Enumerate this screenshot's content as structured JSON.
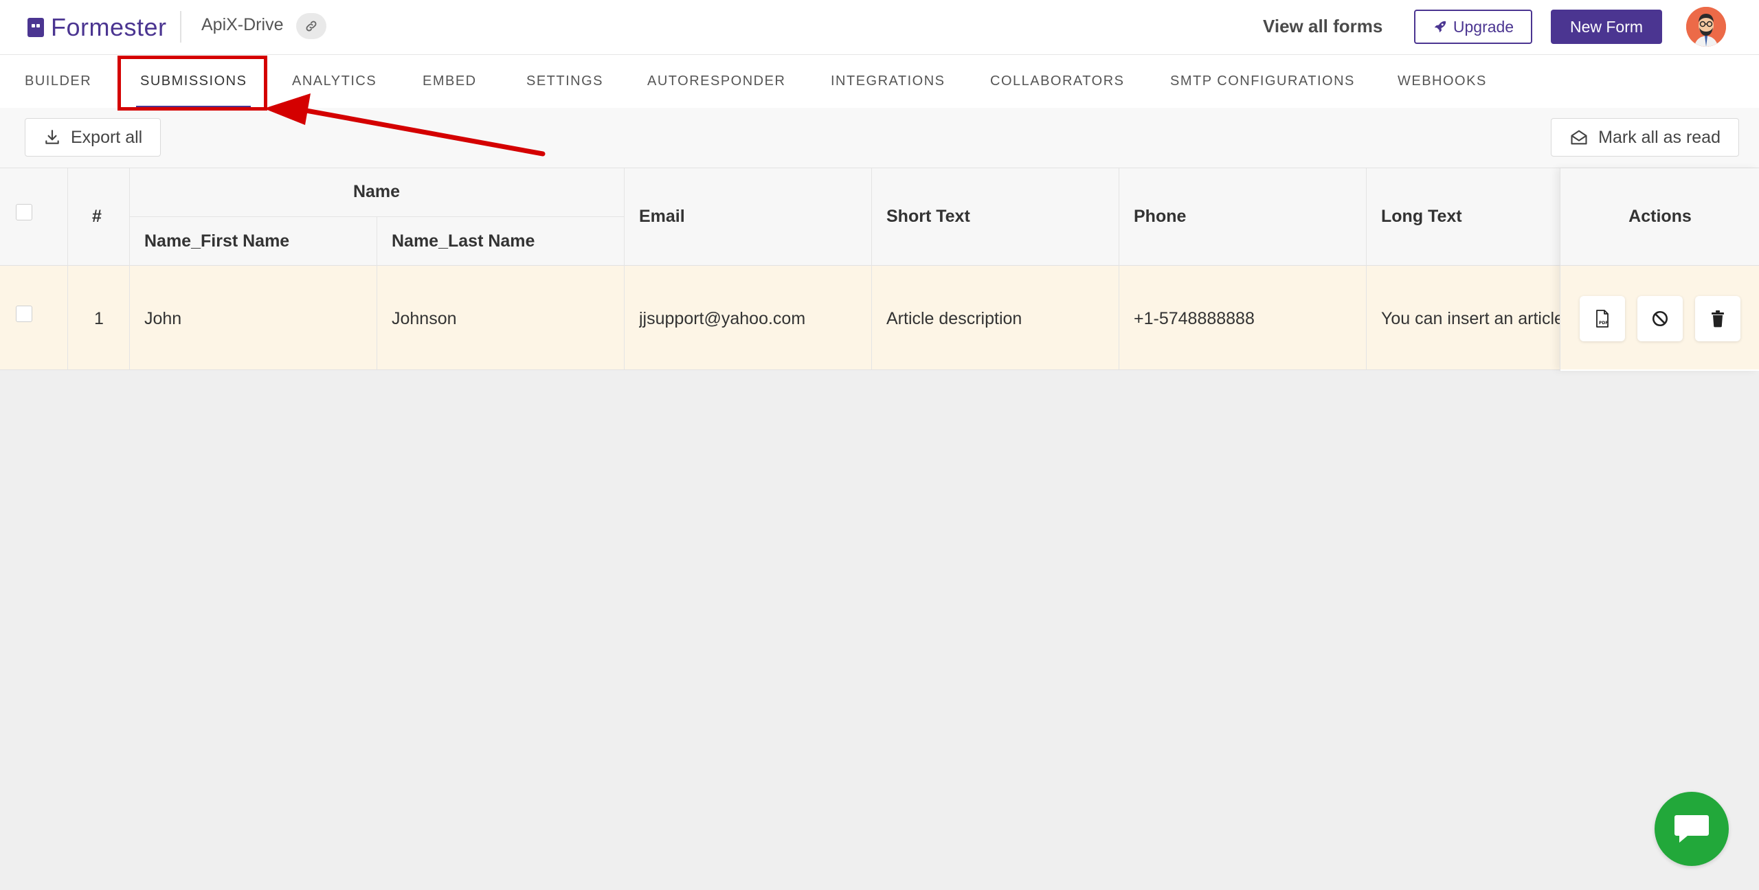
{
  "header": {
    "logo_text": "Formester",
    "form_name": "ApiX-Drive",
    "view_all_forms": "View all forms",
    "upgrade_label": "Upgrade",
    "new_form_label": "New Form"
  },
  "tabs": [
    {
      "label": "BUILDER",
      "active": false
    },
    {
      "label": "SUBMISSIONS",
      "active": true
    },
    {
      "label": "ANALYTICS",
      "active": false
    },
    {
      "label": "EMBED",
      "active": false
    },
    {
      "label": "SETTINGS",
      "active": false
    },
    {
      "label": "AUTORESPONDER",
      "active": false
    },
    {
      "label": "INTEGRATIONS",
      "active": false
    },
    {
      "label": "COLLABORATORS",
      "active": false
    },
    {
      "label": "SMTP CONFIGURATIONS",
      "active": false
    },
    {
      "label": "WEBHOOKS",
      "active": false
    }
  ],
  "toolbar": {
    "export_label": "Export all",
    "mark_read_label": "Mark all as read"
  },
  "table": {
    "headers": {
      "index": "#",
      "name_group": "Name",
      "first_name": "Name_First Name",
      "last_name": "Name_Last Name",
      "email": "Email",
      "short_text": "Short Text",
      "phone": "Phone",
      "long_text": "Long Text",
      "actions": "Actions"
    },
    "rows": [
      {
        "index": "1",
        "first_name": "John",
        "last_name": "Johnson",
        "email": "jjsupport@yahoo.com",
        "short_text": "Article description",
        "phone": "+1-5748888888",
        "long_text": "You can insert an article"
      }
    ]
  },
  "icons": {
    "link": "link-icon",
    "rocket": "rocket-icon",
    "download": "download-icon",
    "envelope_open": "envelope-open-icon",
    "pdf": "pdf-icon",
    "block": "block-icon",
    "trash": "trash-icon",
    "chat": "chat-icon"
  },
  "colors": {
    "brand": "#4b3591",
    "row_highlight": "#fdf5e6",
    "annotation": "#d40000",
    "chat": "#22a83a"
  }
}
